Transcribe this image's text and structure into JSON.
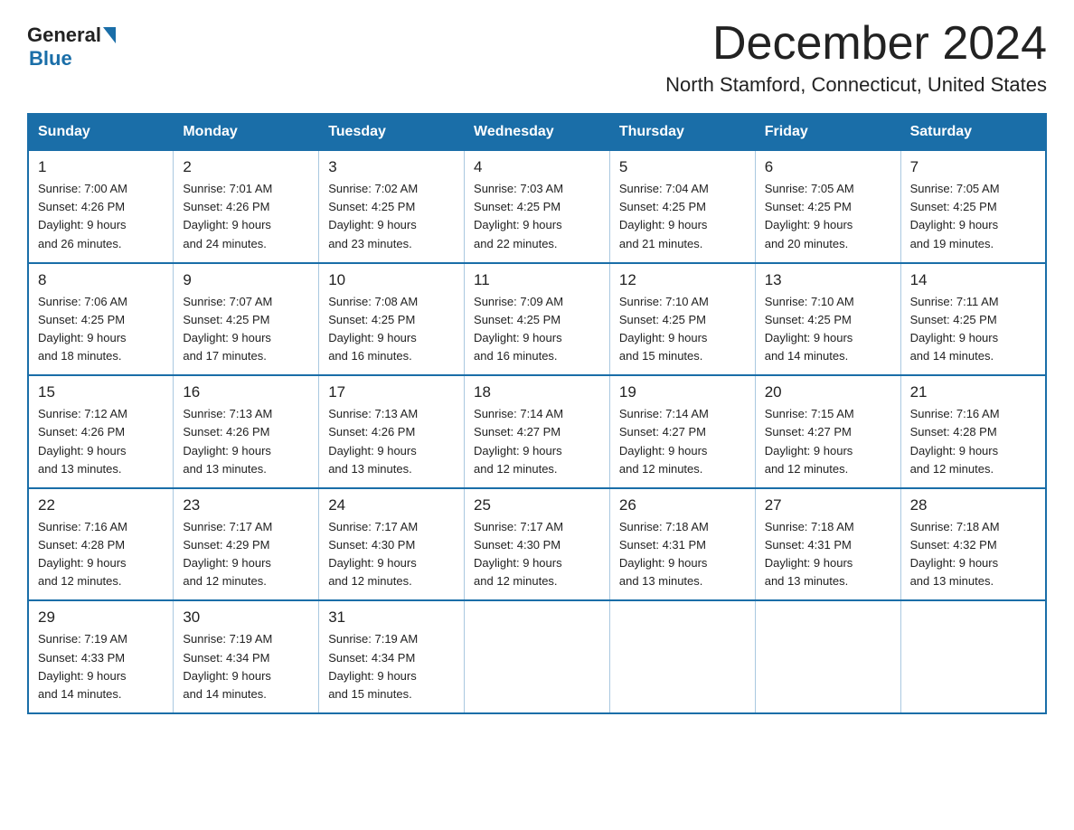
{
  "header": {
    "logo_general": "General",
    "logo_blue": "Blue",
    "month_title": "December 2024",
    "location": "North Stamford, Connecticut, United States"
  },
  "days_of_week": [
    "Sunday",
    "Monday",
    "Tuesday",
    "Wednesday",
    "Thursday",
    "Friday",
    "Saturday"
  ],
  "weeks": [
    [
      {
        "day": "1",
        "sunrise": "7:00 AM",
        "sunset": "4:26 PM",
        "daylight": "9 hours and 26 minutes."
      },
      {
        "day": "2",
        "sunrise": "7:01 AM",
        "sunset": "4:26 PM",
        "daylight": "9 hours and 24 minutes."
      },
      {
        "day": "3",
        "sunrise": "7:02 AM",
        "sunset": "4:25 PM",
        "daylight": "9 hours and 23 minutes."
      },
      {
        "day": "4",
        "sunrise": "7:03 AM",
        "sunset": "4:25 PM",
        "daylight": "9 hours and 22 minutes."
      },
      {
        "day": "5",
        "sunrise": "7:04 AM",
        "sunset": "4:25 PM",
        "daylight": "9 hours and 21 minutes."
      },
      {
        "day": "6",
        "sunrise": "7:05 AM",
        "sunset": "4:25 PM",
        "daylight": "9 hours and 20 minutes."
      },
      {
        "day": "7",
        "sunrise": "7:05 AM",
        "sunset": "4:25 PM",
        "daylight": "9 hours and 19 minutes."
      }
    ],
    [
      {
        "day": "8",
        "sunrise": "7:06 AM",
        "sunset": "4:25 PM",
        "daylight": "9 hours and 18 minutes."
      },
      {
        "day": "9",
        "sunrise": "7:07 AM",
        "sunset": "4:25 PM",
        "daylight": "9 hours and 17 minutes."
      },
      {
        "day": "10",
        "sunrise": "7:08 AM",
        "sunset": "4:25 PM",
        "daylight": "9 hours and 16 minutes."
      },
      {
        "day": "11",
        "sunrise": "7:09 AM",
        "sunset": "4:25 PM",
        "daylight": "9 hours and 16 minutes."
      },
      {
        "day": "12",
        "sunrise": "7:10 AM",
        "sunset": "4:25 PM",
        "daylight": "9 hours and 15 minutes."
      },
      {
        "day": "13",
        "sunrise": "7:10 AM",
        "sunset": "4:25 PM",
        "daylight": "9 hours and 14 minutes."
      },
      {
        "day": "14",
        "sunrise": "7:11 AM",
        "sunset": "4:25 PM",
        "daylight": "9 hours and 14 minutes."
      }
    ],
    [
      {
        "day": "15",
        "sunrise": "7:12 AM",
        "sunset": "4:26 PM",
        "daylight": "9 hours and 13 minutes."
      },
      {
        "day": "16",
        "sunrise": "7:13 AM",
        "sunset": "4:26 PM",
        "daylight": "9 hours and 13 minutes."
      },
      {
        "day": "17",
        "sunrise": "7:13 AM",
        "sunset": "4:26 PM",
        "daylight": "9 hours and 13 minutes."
      },
      {
        "day": "18",
        "sunrise": "7:14 AM",
        "sunset": "4:27 PM",
        "daylight": "9 hours and 12 minutes."
      },
      {
        "day": "19",
        "sunrise": "7:14 AM",
        "sunset": "4:27 PM",
        "daylight": "9 hours and 12 minutes."
      },
      {
        "day": "20",
        "sunrise": "7:15 AM",
        "sunset": "4:27 PM",
        "daylight": "9 hours and 12 minutes."
      },
      {
        "day": "21",
        "sunrise": "7:16 AM",
        "sunset": "4:28 PM",
        "daylight": "9 hours and 12 minutes."
      }
    ],
    [
      {
        "day": "22",
        "sunrise": "7:16 AM",
        "sunset": "4:28 PM",
        "daylight": "9 hours and 12 minutes."
      },
      {
        "day": "23",
        "sunrise": "7:17 AM",
        "sunset": "4:29 PM",
        "daylight": "9 hours and 12 minutes."
      },
      {
        "day": "24",
        "sunrise": "7:17 AM",
        "sunset": "4:30 PM",
        "daylight": "9 hours and 12 minutes."
      },
      {
        "day": "25",
        "sunrise": "7:17 AM",
        "sunset": "4:30 PM",
        "daylight": "9 hours and 12 minutes."
      },
      {
        "day": "26",
        "sunrise": "7:18 AM",
        "sunset": "4:31 PM",
        "daylight": "9 hours and 13 minutes."
      },
      {
        "day": "27",
        "sunrise": "7:18 AM",
        "sunset": "4:31 PM",
        "daylight": "9 hours and 13 minutes."
      },
      {
        "day": "28",
        "sunrise": "7:18 AM",
        "sunset": "4:32 PM",
        "daylight": "9 hours and 13 minutes."
      }
    ],
    [
      {
        "day": "29",
        "sunrise": "7:19 AM",
        "sunset": "4:33 PM",
        "daylight": "9 hours and 14 minutes."
      },
      {
        "day": "30",
        "sunrise": "7:19 AM",
        "sunset": "4:34 PM",
        "daylight": "9 hours and 14 minutes."
      },
      {
        "day": "31",
        "sunrise": "7:19 AM",
        "sunset": "4:34 PM",
        "daylight": "9 hours and 15 minutes."
      },
      null,
      null,
      null,
      null
    ]
  ],
  "labels": {
    "sunrise": "Sunrise:",
    "sunset": "Sunset:",
    "daylight": "Daylight:"
  }
}
